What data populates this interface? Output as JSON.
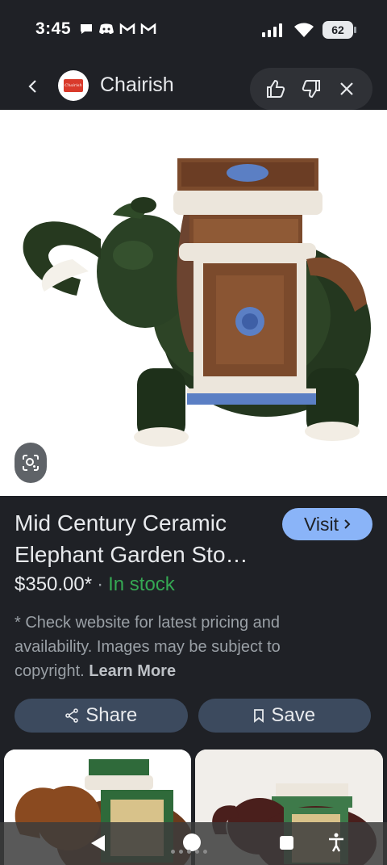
{
  "status_bar": {
    "time": "3:45",
    "battery": "62",
    "icons_left": [
      "chat-bubble-icon",
      "discord-icon",
      "gmail-icon",
      "gmail-icon"
    ],
    "icons_right": [
      "signal-icon",
      "wifi-icon",
      "battery-icon"
    ]
  },
  "header": {
    "site_name": "Chairish",
    "logo_text": "Chairish",
    "icons": [
      "back-arrow-icon",
      "thumbs-up-icon",
      "thumbs-down-icon",
      "close-icon"
    ]
  },
  "product": {
    "title": "Mid Century Ceramic Elephant Garden Sto…",
    "visit_label": "Visit",
    "price": "$350.00*",
    "separator": "·",
    "stock": "In stock",
    "disclaimer": "* Check website for latest pricing and availability. Images may be subject to copyright.",
    "learn_more": "Learn More",
    "share_label": "Share",
    "save_label": "Save"
  },
  "colors": {
    "background": "#1f2126",
    "accent": "#8ab4f8",
    "stock_green": "#35a853",
    "button_bg": "#3c4a5e"
  }
}
